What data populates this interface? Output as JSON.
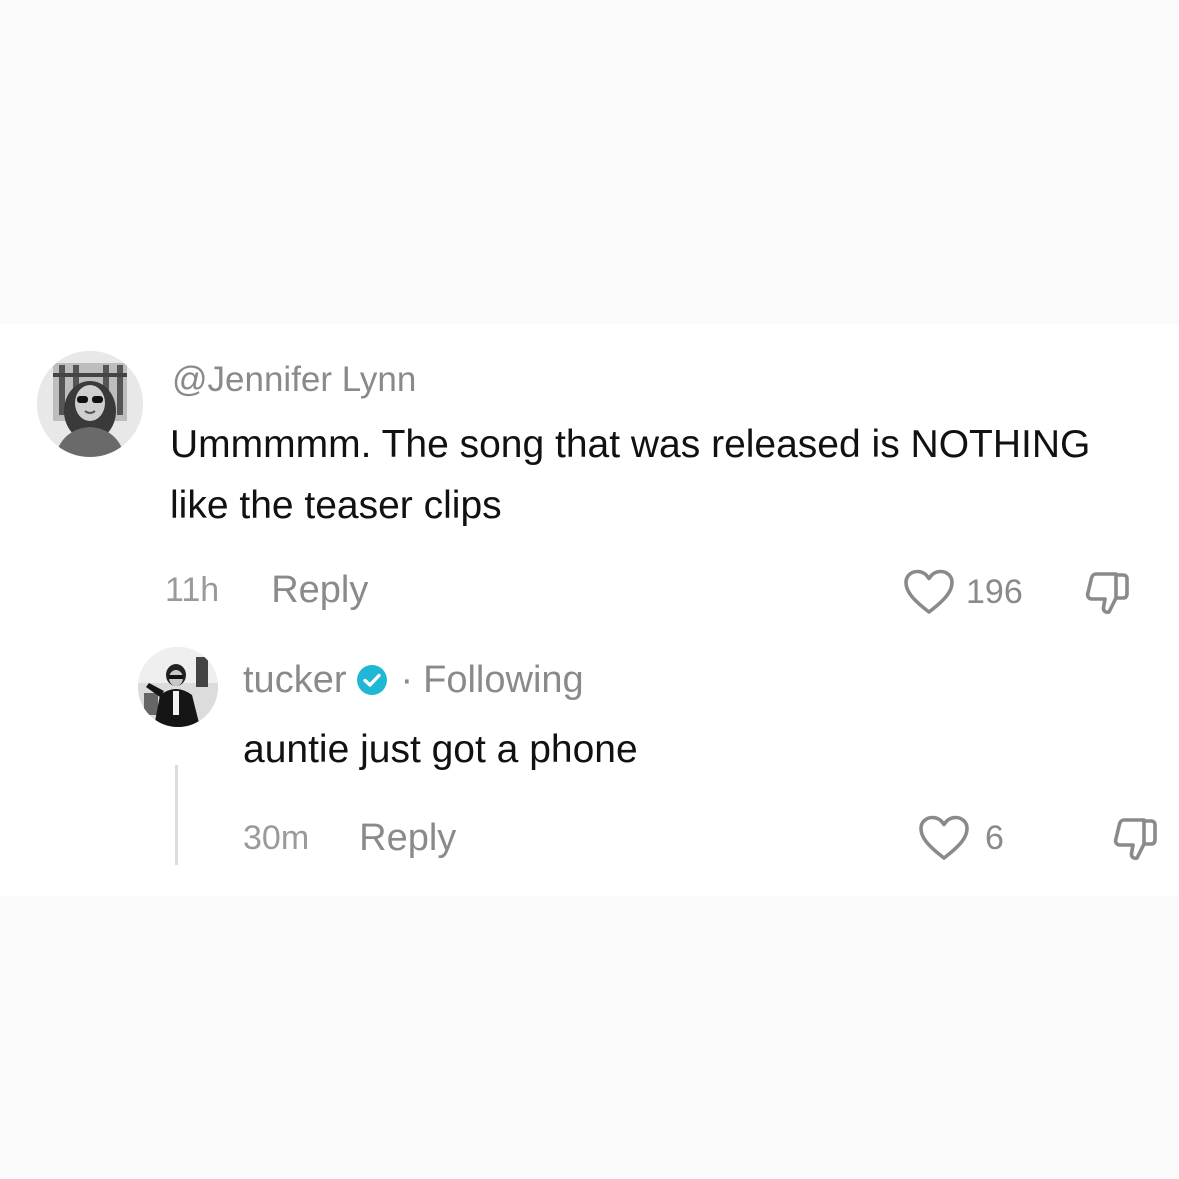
{
  "comment": {
    "username": "@Jennifer Lynn",
    "text": "Ummmmm. The song that was released is NOTHING like the teaser clips",
    "timestamp": "11h",
    "reply_label": "Reply",
    "like_count": "196",
    "avatar_icon": "avatar-photo"
  },
  "reply": {
    "username": "tucker",
    "verified_icon": "verified-badge-icon",
    "separator": "·",
    "following_label": "Following",
    "text": "auntie just got a phone",
    "timestamp": "30m",
    "reply_label": "Reply",
    "like_count": "6",
    "avatar_icon": "avatar-photo"
  },
  "icons": {
    "like": "heart-outline-icon",
    "dislike": "thumbs-down-icon"
  },
  "colors": {
    "background": "#fafafa",
    "card": "#ffffff",
    "primary_text": "#111111",
    "secondary_text": "#8a8a8a",
    "verified": "#20b7d6"
  }
}
